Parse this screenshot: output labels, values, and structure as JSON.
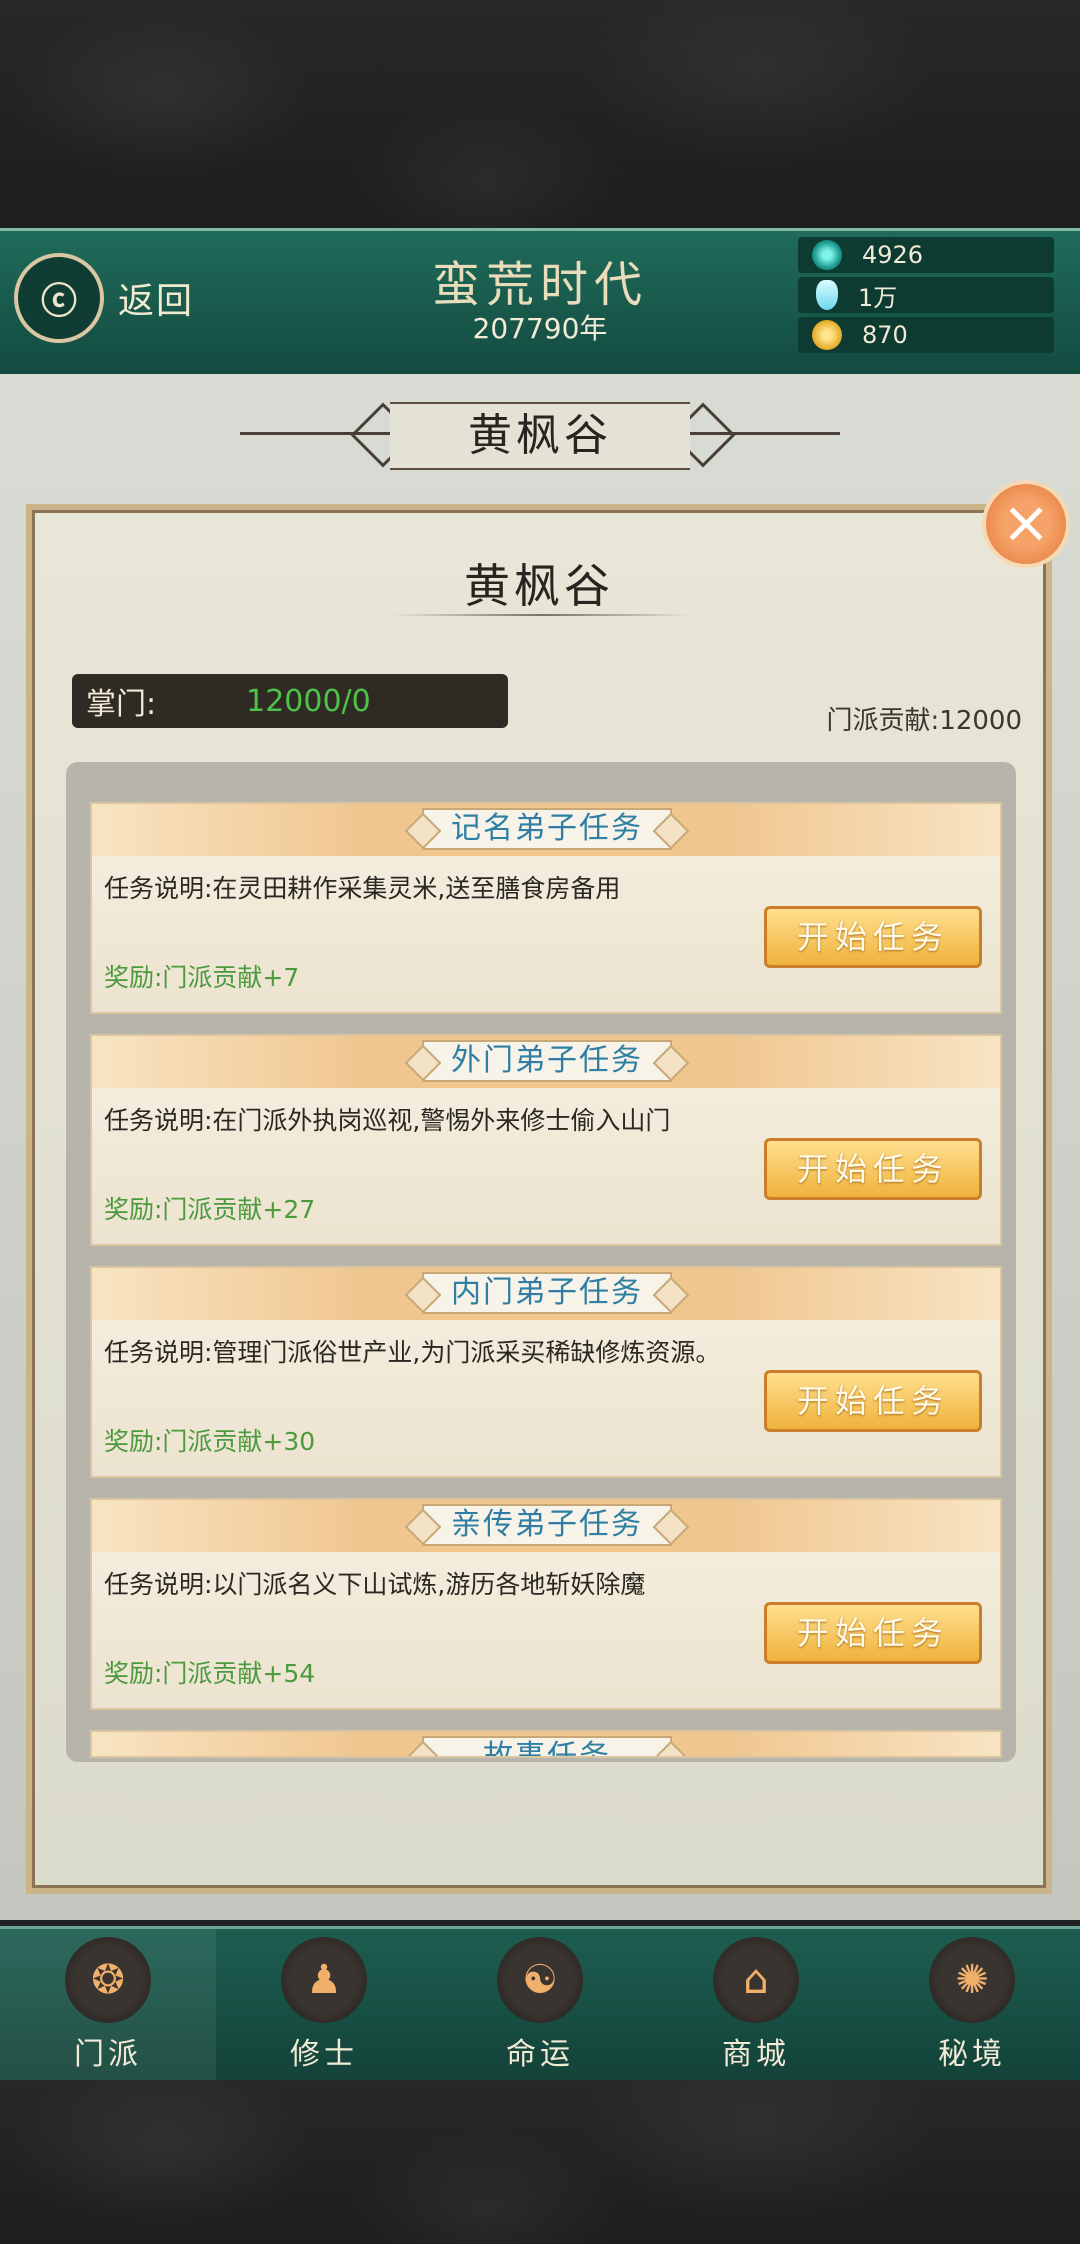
{
  "header": {
    "back_label": "返回",
    "era_title": "蛮荒时代",
    "era_year": "207790年",
    "resources": [
      {
        "icon": "jade-gem-icon",
        "value": "4926"
      },
      {
        "icon": "spirit-crystal-icon",
        "value": "1万"
      },
      {
        "icon": "gold-ingot-icon",
        "value": "870"
      }
    ]
  },
  "banner": {
    "title": "黄枫谷"
  },
  "dialog": {
    "title": "黄枫谷",
    "leader_label": "掌门:",
    "leader_value": "12000/0",
    "contribution": "门派贡献:12000",
    "tasks": [
      {
        "title": "记名弟子任务",
        "desc": "任务说明:在灵田耕作采集灵米,送至膳食房备用",
        "reward": "奖励:门派贡献+7",
        "button": "开始任务"
      },
      {
        "title": "外门弟子任务",
        "desc": "任务说明:在门派外执岗巡视,警惕外来修士偷入山门",
        "reward": "奖励:门派贡献+27",
        "button": "开始任务"
      },
      {
        "title": "内门弟子任务",
        "desc": "任务说明:管理门派俗世产业,为门派采买稀缺修炼资源。",
        "reward": "奖励:门派贡献+30",
        "button": "开始任务"
      },
      {
        "title": "亲传弟子任务",
        "desc": "任务说明:以门派名义下山试炼,游历各地斩妖除魔",
        "reward": "奖励:门派贡献+54",
        "button": "开始任务"
      },
      {
        "title": "故事任务"
      }
    ]
  },
  "nav": [
    {
      "label": "门派",
      "icon": "sect-icon"
    },
    {
      "label": "修士",
      "icon": "cultivator-icon"
    },
    {
      "label": "命运",
      "icon": "fate-icon"
    },
    {
      "label": "商城",
      "icon": "shop-icon"
    },
    {
      "label": "秘境",
      "icon": "secret-realm-icon"
    }
  ],
  "colors": {
    "header_green": "#1f6b5a",
    "button_gold": "#f0b23c",
    "reward_green": "#4c9a3e",
    "title_blue": "#2f7ea4"
  }
}
